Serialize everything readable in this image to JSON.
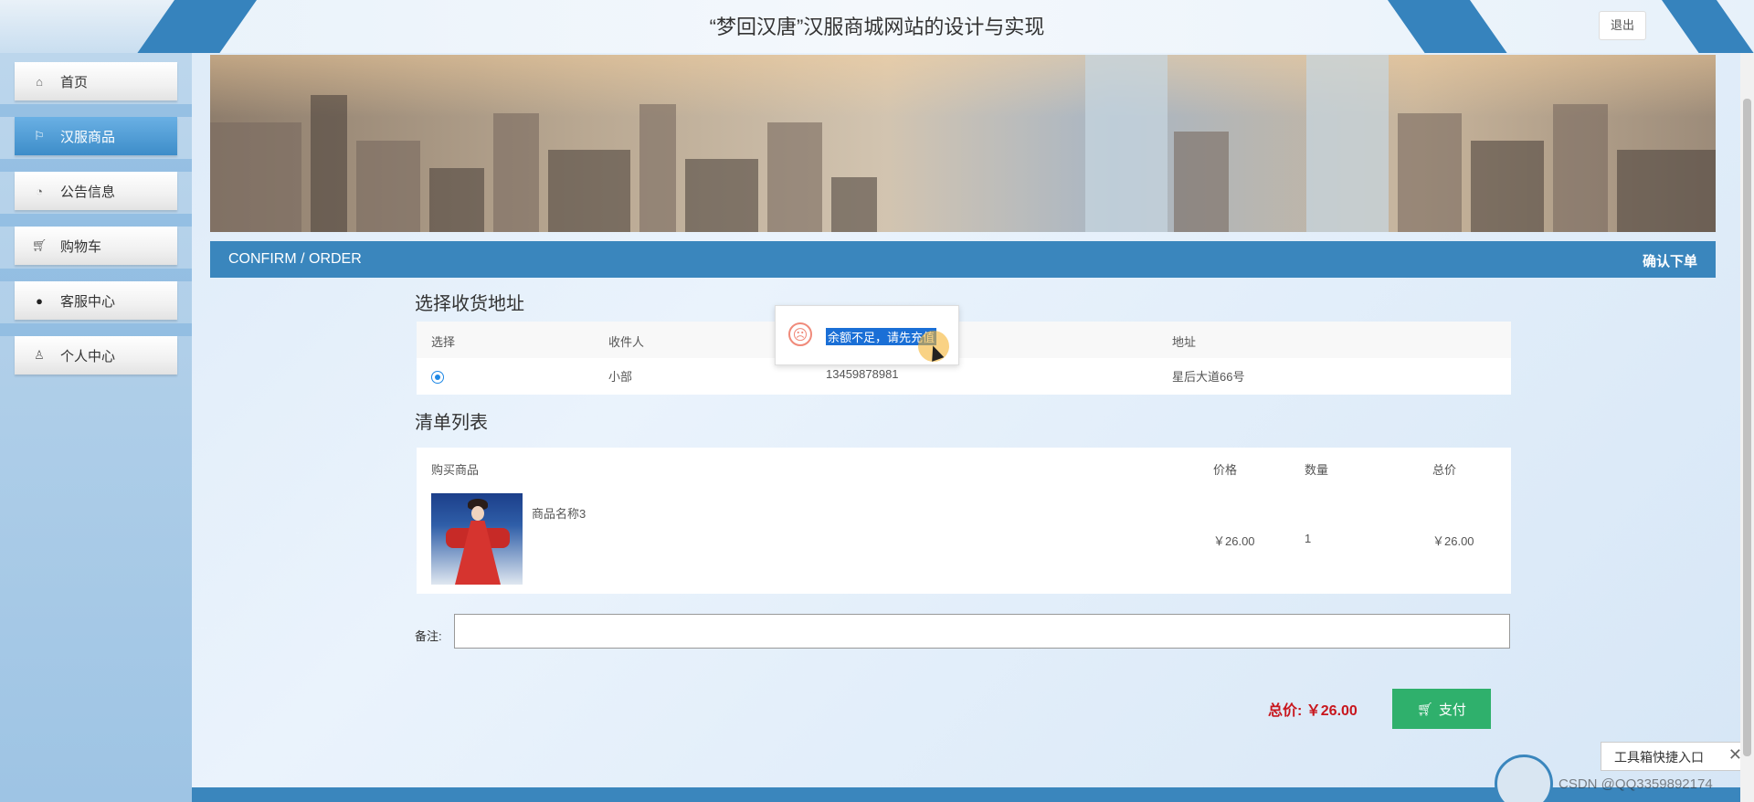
{
  "header": {
    "title": "“梦回汉唐”汉服商城网站的设计与实现",
    "logout_label": "退出"
  },
  "sidebar": {
    "items": [
      {
        "label": "首页",
        "icon": "home-icon"
      },
      {
        "label": "汉服商品",
        "icon": "flag-icon"
      },
      {
        "label": "公告信息",
        "icon": "gauge-icon"
      },
      {
        "label": "购物车",
        "icon": "cart-icon"
      },
      {
        "label": "客服中心",
        "icon": "chat-icon"
      },
      {
        "label": "个人中心",
        "icon": "user-icon"
      }
    ],
    "active_item": "汉服商品"
  },
  "confirm_bar": {
    "left_label": "CONFIRM / ORDER",
    "right_label": "确认下单"
  },
  "address_section": {
    "title": "选择收货地址",
    "headers": [
      "选择",
      "收件人",
      "地址"
    ],
    "rows": [
      {
        "selected": true,
        "recipient": "小部",
        "phone": "13459878981",
        "address": "星后大道66号"
      }
    ]
  },
  "order_section": {
    "title": "清单列表",
    "headers": [
      "购买商品",
      "价格",
      "数量",
      "总价"
    ],
    "items": [
      {
        "name": "商品名称3",
        "price": "￥26.00",
        "quantity": "1",
        "total": "￥26.00"
      }
    ]
  },
  "remark": {
    "label": "备注:",
    "value": ""
  },
  "summary": {
    "total_label": "总价: ￥26.00",
    "pay_label": "支付"
  },
  "toast": {
    "message": "余额不足，请先充值"
  },
  "overlay": {
    "toolbox_label": "工具箱快捷入口",
    "watermark": "CSDN @QQ3359892174"
  },
  "colors": {
    "accent": "#3a86bd",
    "pay_button": "#2fb06c",
    "total_text": "#c8161d"
  }
}
